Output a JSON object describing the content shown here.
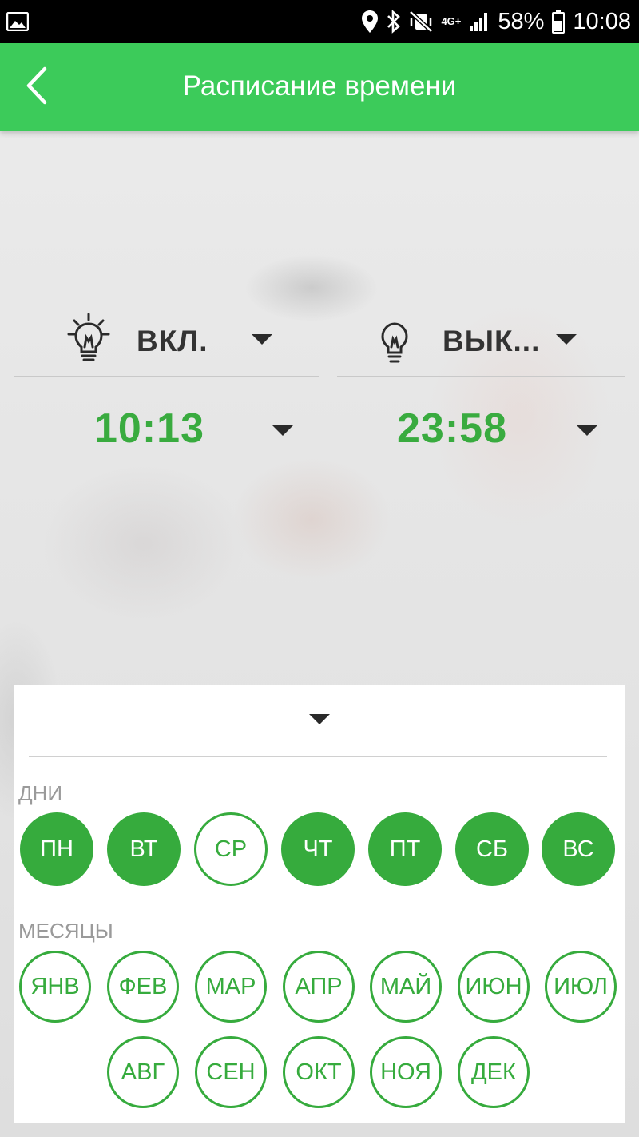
{
  "status_bar": {
    "network_type": "4G+",
    "battery": "58%",
    "time": "10:08"
  },
  "app_bar": {
    "title": "Расписание времени"
  },
  "schedule": {
    "on": {
      "label": "ВКЛ.",
      "time": "10:13"
    },
    "off": {
      "label": "ВЫК...",
      "time": "23:58"
    }
  },
  "days": {
    "title": "ДНИ",
    "items": [
      {
        "label": "ПН",
        "selected": true
      },
      {
        "label": "ВТ",
        "selected": true
      },
      {
        "label": "СР",
        "selected": false
      },
      {
        "label": "ЧТ",
        "selected": true
      },
      {
        "label": "ПТ",
        "selected": true
      },
      {
        "label": "СБ",
        "selected": true
      },
      {
        "label": "ВС",
        "selected": true
      }
    ]
  },
  "months": {
    "title": "МЕСЯЦЫ",
    "items": [
      {
        "label": "ЯНВ",
        "selected": false
      },
      {
        "label": "ФЕВ",
        "selected": false
      },
      {
        "label": "МАР",
        "selected": false
      },
      {
        "label": "АПР",
        "selected": false
      },
      {
        "label": "МАЙ",
        "selected": false
      },
      {
        "label": "ИЮН",
        "selected": false
      },
      {
        "label": "ИЮЛ",
        "selected": false
      },
      {
        "label": "АВГ",
        "selected": false
      },
      {
        "label": "СЕН",
        "selected": false
      },
      {
        "label": "ОКТ",
        "selected": false
      },
      {
        "label": "НОЯ",
        "selected": false
      },
      {
        "label": "ДЕК",
        "selected": false
      }
    ]
  },
  "colors": {
    "accent": "#3ccb5a",
    "selected_fill": "#36ab3d",
    "time_text": "#39ab3f"
  },
  "icons": {
    "status_bar": [
      "gallery-icon",
      "location-icon",
      "bluetooth-icon",
      "mute-vibrate-icon",
      "signal-icon",
      "battery-icon"
    ],
    "back": "chevron-left-icon",
    "on": "lightbulb-on-icon",
    "off": "lightbulb-off-icon",
    "dropdown": "caret-down-icon"
  }
}
